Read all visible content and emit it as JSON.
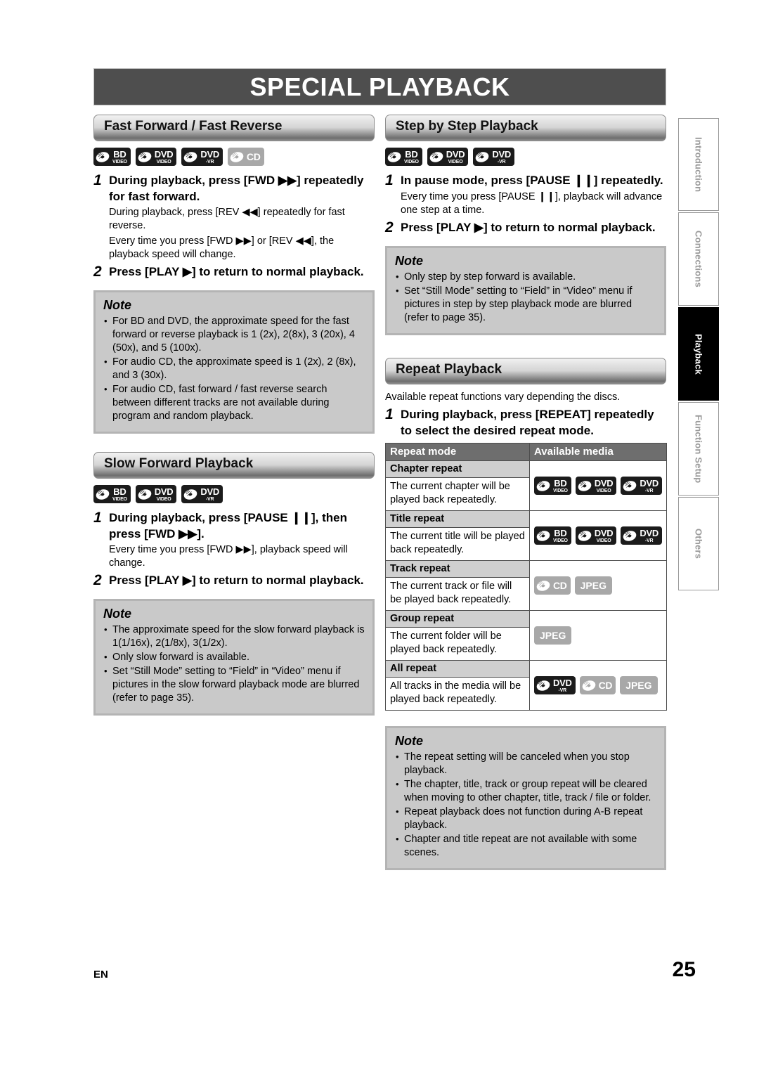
{
  "page": {
    "title": "SPECIAL PLAYBACK",
    "language_code": "EN",
    "page_number": "25"
  },
  "colors": {
    "title_bar": "#4e4e4e",
    "table_header": "#6e6e6e",
    "note_bg": "#c9c9c9",
    "badge_dark": "#1b1b1b",
    "badge_gray": "#a8a8a8",
    "active_tab": "#000000"
  },
  "sidebar": {
    "tabs": [
      {
        "label": "Introduction",
        "active": false
      },
      {
        "label": "Connections",
        "active": false
      },
      {
        "label": "Playback",
        "active": true
      },
      {
        "label": "Function Setup",
        "active": false
      },
      {
        "label": "Others",
        "active": false
      }
    ]
  },
  "sections": {
    "fast_forward": {
      "heading": "Fast Forward / Fast Reverse",
      "media": [
        "BD VIDEO",
        "DVD VIDEO",
        "DVD -VR",
        "CD"
      ],
      "step1_num": "1",
      "step1_text": "During playback, press [FWD ▶▶] repeatedly for fast forward.",
      "body1": "During playback, press [REV ◀◀] repeatedly for fast reverse.",
      "body2": "Every time you press [FWD ▶▶] or [REV ◀◀], the playback speed will change.",
      "step2_num": "2",
      "step2_text": "Press [PLAY ▶] to return to normal playback.",
      "note_title": "Note",
      "note_items": [
        "For BD and DVD, the approximate speed for the fast forward or reverse playback is 1 (2x), 2(8x), 3 (20x), 4 (50x), and 5 (100x).",
        "For audio CD, the approximate speed is 1 (2x), 2 (8x), and 3 (30x).",
        "For audio CD, fast forward / fast reverse search between different tracks are not available during program and random playback."
      ]
    },
    "slow_forward": {
      "heading": "Slow Forward Playback",
      "media": [
        "BD VIDEO",
        "DVD VIDEO",
        "DVD -VR"
      ],
      "step1_num": "1",
      "step1_text": "During playback, press [PAUSE ❙❙], then press [FWD ▶▶].",
      "body1": "Every time you press [FWD ▶▶], playback speed will change.",
      "step2_num": "2",
      "step2_text": "Press [PLAY ▶] to return to normal playback.",
      "note_title": "Note",
      "note_items": [
        "The approximate speed for the slow forward playback is 1(1/16x), 2(1/8x), 3(1/2x).",
        "Only slow forward is available.",
        "Set “Still Mode” setting to “Field” in “Video” menu if pictures in the slow forward playback mode are blurred (refer to page 35)."
      ]
    },
    "step_by_step": {
      "heading": "Step by Step Playback",
      "media": [
        "BD VIDEO",
        "DVD VIDEO",
        "DVD -VR"
      ],
      "step1_num": "1",
      "step1_text": "In pause mode, press [PAUSE ❙❙] repeatedly.",
      "body1": "Every time you press [PAUSE ❙❙], playback will advance one step at a time.",
      "step2_num": "2",
      "step2_text": "Press [PLAY ▶] to return to normal playback.",
      "note_title": "Note",
      "note_items": [
        "Only step by step forward is available.",
        "Set “Still Mode” setting to “Field” in “Video” menu if pictures in step by step playback mode are blurred (refer to page 35)."
      ]
    },
    "repeat": {
      "heading": "Repeat Playback",
      "intro": "Available repeat functions vary depending the discs.",
      "step1_num": "1",
      "step1_text": "During playback, press [REPEAT] repeatedly to select the desired repeat mode.",
      "table": {
        "headers": [
          "Repeat mode",
          "Available media"
        ],
        "rows": [
          {
            "mode": "Chapter repeat",
            "desc": "The current chapter will be played back repeatedly.",
            "media": [
              "BD VIDEO",
              "DVD VIDEO",
              "DVD -VR"
            ]
          },
          {
            "mode": "Title repeat",
            "desc": "The current title will be played back repeatedly.",
            "media": [
              "BD VIDEO",
              "DVD VIDEO",
              "DVD -VR"
            ]
          },
          {
            "mode": "Track repeat",
            "desc": "The current track or file will be played back repeatedly.",
            "media": [
              "CD",
              "JPEG"
            ]
          },
          {
            "mode": "Group repeat",
            "desc": "The current folder will be played back repeatedly.",
            "media": [
              "JPEG"
            ]
          },
          {
            "mode": "All repeat",
            "desc": "All tracks in the media will be played back repeatedly.",
            "media": [
              "DVD -VR",
              "CD",
              "JPEG"
            ]
          }
        ]
      },
      "note_title": "Note",
      "note_items": [
        "The repeat setting will be canceled when you stop playback.",
        "The chapter, title, track or group repeat will be cleared when moving to other chapter, title, track / file or folder.",
        "Repeat playback does not function during A-B repeat playback.",
        "Chapter and title repeat are not available with some scenes."
      ]
    }
  }
}
